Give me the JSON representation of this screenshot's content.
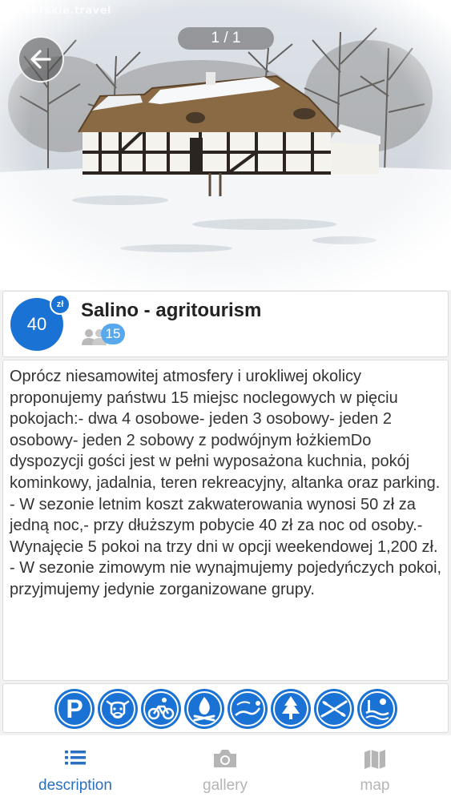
{
  "photo": {
    "watermark": "pomorskie.travel",
    "counter": "1 / 1"
  },
  "listing": {
    "price": "40",
    "currency": "zł",
    "title": "Salino - agritourism",
    "guests": "15"
  },
  "description": "Oprócz niesamowitej atmosfery i urokliwej okolicy proponujemy państwu 15 miejsc noclegowych w pięciu pokojach:- dwa 4 osobowe- jeden 3 osobowy- jeden 2 osobowy- jeden 2 sobowy z podwójnym łożkiemDo dyspozycji gości jest w pełni wyposażona kuchnia, pokój kominkowy, jadalnia, teren rekreacyjny, altanka oraz parking.\n- W sezonie letnim koszt zakwaterowania wynosi 50 zł za jedną noc,- przy dłuższym pobycie 40 zł za noc od osoby.- Wynajęcie 5 pokoi na trzy dni w opcji weekendowej 1,200 zł.\n- W sezonie zimowym nie wynajmujemy pojedyńczych pokoi, przyjmujemy jedynie zorganizowane grupy.",
  "amenities": [
    {
      "icon": "parking-icon"
    },
    {
      "icon": "cow-icon"
    },
    {
      "icon": "bicycle-icon"
    },
    {
      "icon": "campfire-icon"
    },
    {
      "icon": "trail-icon"
    },
    {
      "icon": "forest-icon"
    },
    {
      "icon": "kayak-icon"
    },
    {
      "icon": "beach-icon"
    }
  ],
  "nav": {
    "active_color": "#2a6fc0",
    "inactive_color": "#b5b5b5",
    "items": [
      {
        "label": "description",
        "icon": "list-icon"
      },
      {
        "label": "gallery",
        "icon": "camera-icon"
      },
      {
        "label": "map",
        "icon": "map-icon"
      }
    ]
  },
  "colors": {
    "accent": "#1a73d4",
    "badge": "#58a8ee"
  }
}
